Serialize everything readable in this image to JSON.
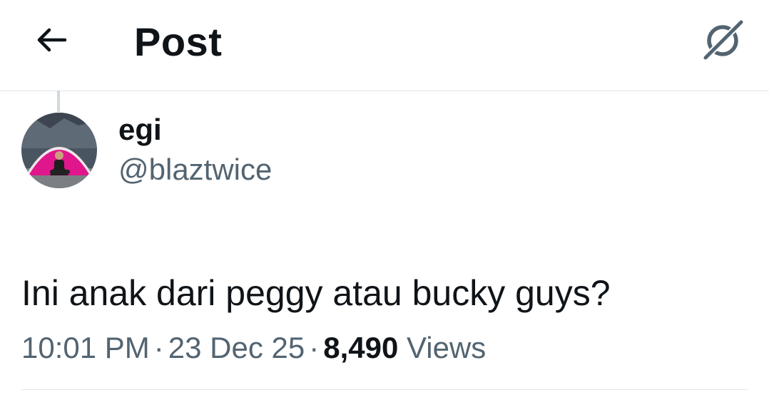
{
  "header": {
    "title": "Post",
    "back_icon": "arrow-left-icon",
    "grok_icon": "grok-icon"
  },
  "tweet": {
    "author": {
      "display_name": "egi",
      "handle": "@blaztwice"
    },
    "text": "Ini anak dari peggy atau bucky guys?",
    "time": "10:01 PM",
    "separator": "·",
    "date": "23 Dec 25",
    "views_count": "8,490",
    "views_label": "Views"
  },
  "colors": {
    "text_primary": "#0f1419",
    "text_secondary": "#536471",
    "divider": "#e1e4e7"
  }
}
